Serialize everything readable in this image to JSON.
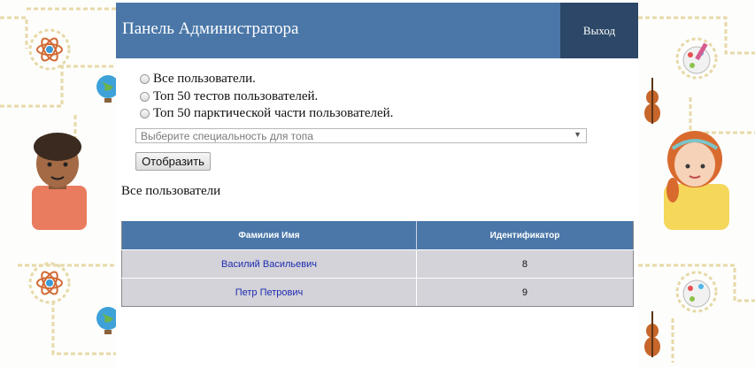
{
  "header": {
    "title": "Панель Администратора",
    "logout_label": "Выход"
  },
  "filters": {
    "options": [
      "Все пользователи.",
      "Топ 50 тестов пользователей.",
      "Топ 50 парктической части пользователей."
    ],
    "select_placeholder": "Выберите специальность для топа",
    "show_button": "Отобразить"
  },
  "section_title": "Все пользователи",
  "table": {
    "headers": [
      "Фамилия Имя",
      "Идентификатор"
    ],
    "rows": [
      {
        "name": "Василий Васильевич",
        "id": "8"
      },
      {
        "name": "Петр Петрович",
        "id": "9"
      }
    ]
  },
  "colors": {
    "header": "#4a77a8",
    "logout": "#2c4767",
    "row": "#d3d3d9",
    "link": "#1f2bb0"
  }
}
